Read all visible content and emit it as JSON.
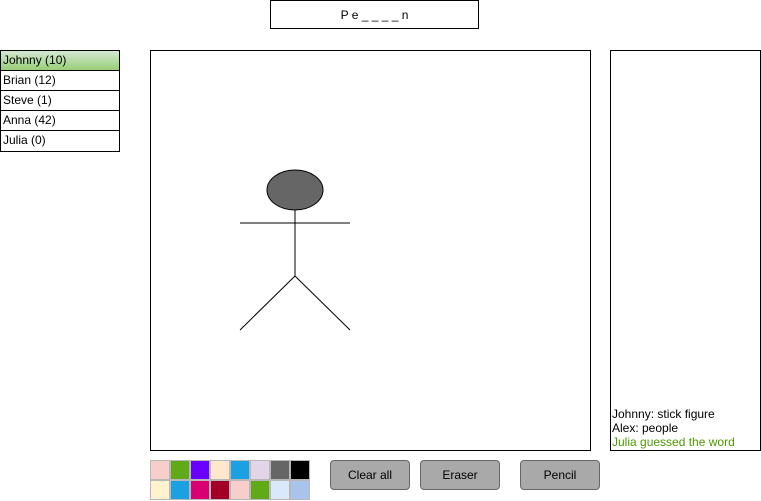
{
  "word_hint": "P e _ _ _ _ n",
  "players": [
    {
      "label": "Johnny (10)",
      "active": true
    },
    {
      "label": "Brian (12)",
      "active": false
    },
    {
      "label": "Steve (1)",
      "active": false
    },
    {
      "label": "Anna (42)",
      "active": false
    },
    {
      "label": "Julia (0)",
      "active": false
    }
  ],
  "canvas": {
    "drawing": "stick-figure",
    "head_color": "#666666"
  },
  "chat": {
    "messages": [
      {
        "text": "Johnny: stick figure",
        "type": "normal"
      },
      {
        "text": "Alex: people",
        "type": "normal"
      },
      {
        "text": "Julia guessed the word",
        "type": "success"
      }
    ],
    "success_color": "#4d9900"
  },
  "palette": {
    "colors": [
      "#f8cecc",
      "#60a917",
      "#6a00ff",
      "#ffe6cc",
      "#1ba1e2",
      "#e1d5e7",
      "#666666",
      "#000000",
      "#fff2cc",
      "#1ba1e2",
      "#d80073",
      "#a20025",
      "#f8cecc",
      "#60a917",
      "#dae8fc",
      "#a9c4eb"
    ]
  },
  "tools": {
    "clear_label": "Clear all",
    "eraser_label": "Eraser",
    "pencil_label": "Pencil"
  },
  "active_player_color": "#97d077",
  "button_color": "#a9a9a9"
}
